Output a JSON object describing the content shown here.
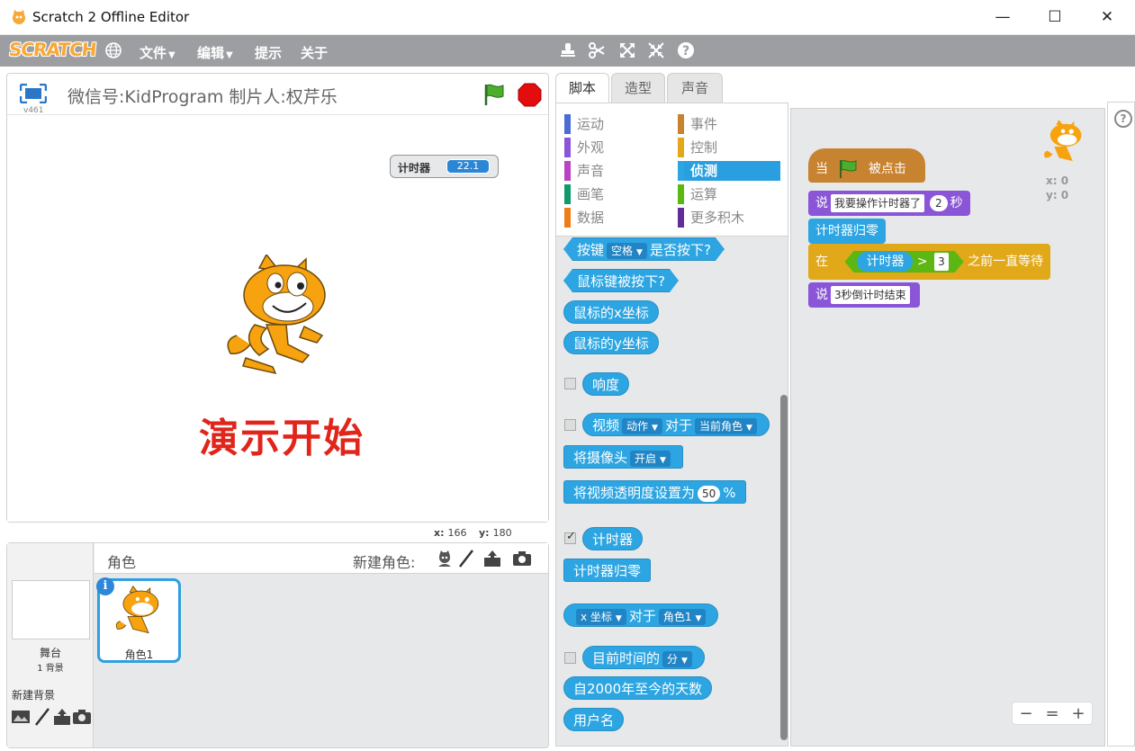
{
  "window": {
    "title": "Scratch 2 Offline Editor",
    "minimize": "—",
    "maximize": "☐",
    "close": "✕"
  },
  "menubar": {
    "logo": "SCRATCH",
    "file": "文件",
    "edit": "编辑",
    "tips": "提示",
    "about": "关于"
  },
  "stage": {
    "version": "v461",
    "project_title": "微信号:KidProgram 制片人:权芹乐",
    "monitor_label": "计时器",
    "monitor_value": "22.1",
    "overlay_text": "演示开始",
    "x_label": "x:",
    "x_value": "166",
    "y_label": "y:",
    "y_value": "180"
  },
  "sprites": {
    "header": "角色",
    "new_sprite": "新建角色:",
    "stage_name": "舞台",
    "stage_backdrops": "1 背景",
    "new_backdrop": "新建背景",
    "sprite1": "角色1",
    "info": "i"
  },
  "tabs": {
    "scripts": "脚本",
    "costumes": "造型",
    "sounds": "声音"
  },
  "categories": {
    "motion": "运动",
    "looks": "外观",
    "sound": "声音",
    "pen": "画笔",
    "data": "数据",
    "events": "事件",
    "control": "控制",
    "sensing": "侦测",
    "operators": "运算",
    "more": "更多积木"
  },
  "colors": {
    "motion": "#4a6cd4",
    "looks": "#8a55d7",
    "sound": "#bb42c3",
    "pen": "#0e9a6c",
    "data": "#ee7d16",
    "events": "#c88330",
    "control": "#e1a91a",
    "sensing": "#2ca5e2",
    "operators": "#5cb712",
    "more": "#632d99"
  },
  "palette": {
    "key_pressed_a": "按键",
    "key_option": "空格",
    "key_pressed_b": "是否按下?",
    "mouse_down": "鼠标键被按下?",
    "mouse_x": "鼠标的x坐标",
    "mouse_y": "鼠标的y坐标",
    "loudness": "响度",
    "video_a": "视频",
    "video_opt1": "动作",
    "video_b": "对于",
    "video_opt2": "当前角色",
    "turn_video": "将摄像头",
    "turn_video_opt": "开启",
    "transparency_a": "将视频透明度设置为",
    "transparency_val": "50",
    "transparency_b": "%",
    "timer": "计时器",
    "reset_timer": "计时器归零",
    "of_opt1": "x 坐标",
    "of_b": "对于",
    "of_opt2": "角色1",
    "current_a": "目前时间的",
    "current_opt": "分",
    "days_since": "自2000年至今的天数",
    "username": "用户名"
  },
  "script": {
    "hat_a": "当",
    "hat_b": "被点击",
    "say_a": "说",
    "say_text": "我要操作计时器了",
    "say_secs": "2",
    "say_b": "秒",
    "reset": "计时器归零",
    "wait_a": "在",
    "wait_timer": "计时器",
    "wait_op": ">",
    "wait_val": "3",
    "wait_b": "之前一直等待",
    "say2_a": "说",
    "say2_text": "3秒倒计时结束"
  },
  "sprite_info": {
    "x": "x: 0",
    "y": "y: 0"
  },
  "zoom": {
    "out": "−",
    "reset": "=",
    "in": "+"
  },
  "help": "?"
}
